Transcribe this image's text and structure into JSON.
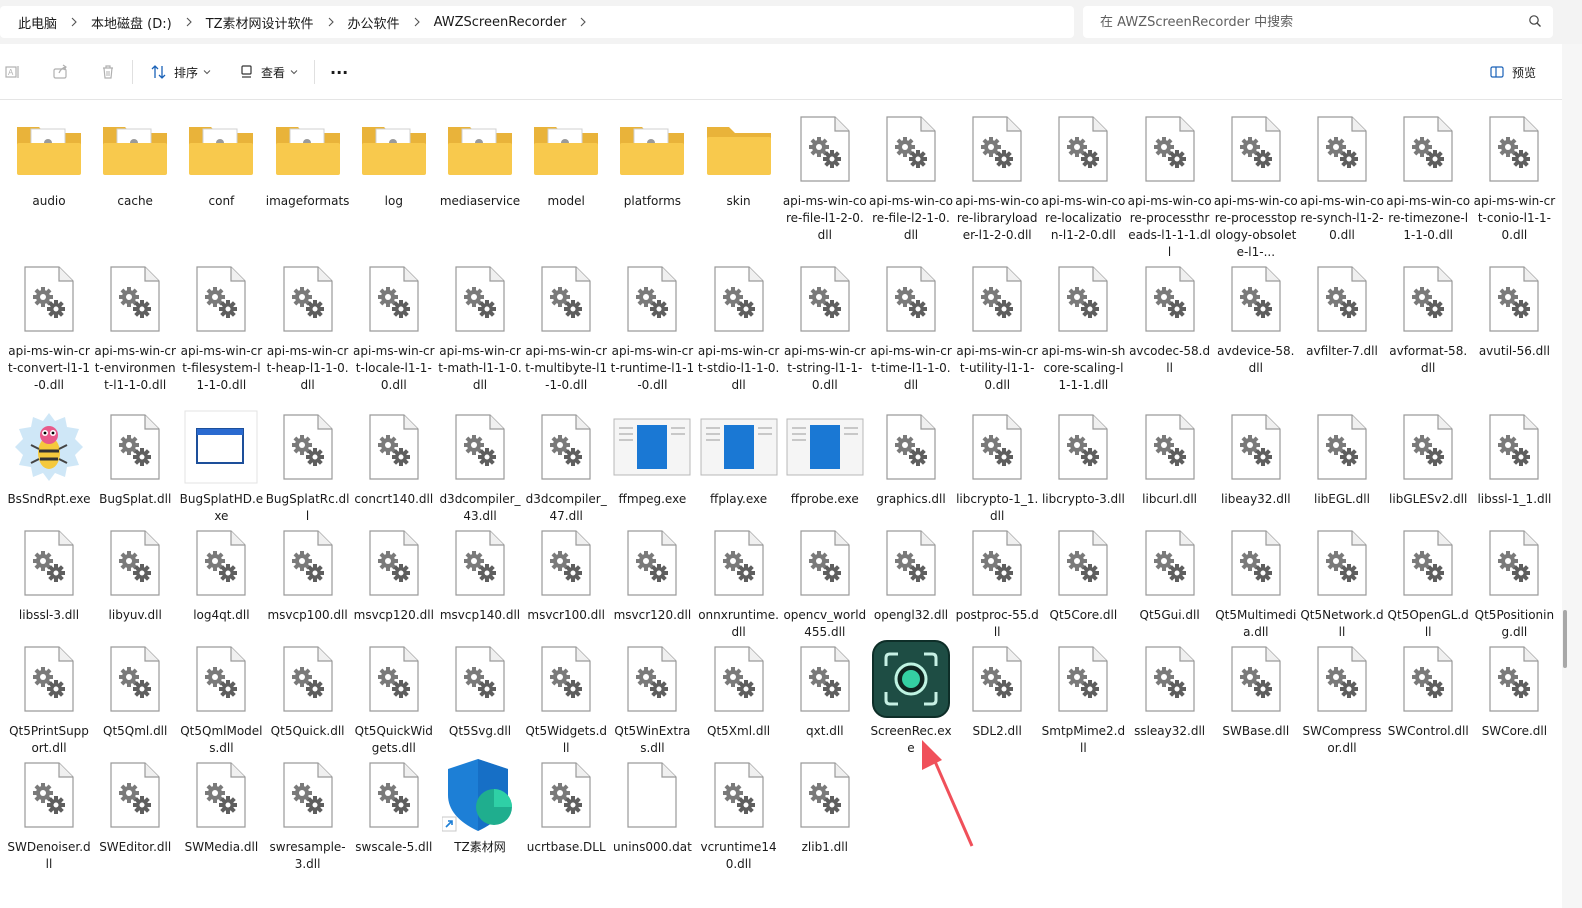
{
  "breadcrumb": [
    "此电脑",
    "本地磁盘 (D:)",
    "TZ素材网设计软件",
    "办公软件",
    "AWZScreenRecorder"
  ],
  "search": {
    "placeholder": "在 AWZScreenRecorder 中搜索"
  },
  "toolbar": {
    "sort_label": "排序",
    "view_label": "查看",
    "more_label": "···",
    "preview_label": "预览"
  },
  "colors": {
    "folder": "#f8c94d",
    "accent": "#0067c0",
    "arrow": "#f0505a",
    "app_icon_bg": "#1e4d44"
  },
  "files": [
    {
      "name": "audio",
      "icon": "folder-doc"
    },
    {
      "name": "cache",
      "icon": "folder-doc"
    },
    {
      "name": "conf",
      "icon": "folder-doc"
    },
    {
      "name": "imageformats",
      "icon": "folder-doc"
    },
    {
      "name": "log",
      "icon": "folder-doc"
    },
    {
      "name": "mediaservice",
      "icon": "folder-doc"
    },
    {
      "name": "model",
      "icon": "folder-doc"
    },
    {
      "name": "platforms",
      "icon": "folder-doc"
    },
    {
      "name": "skin",
      "icon": "folder"
    },
    {
      "name": "api-ms-win-core-file-l1-2-0.dll",
      "icon": "dll"
    },
    {
      "name": "api-ms-win-core-file-l2-1-0.dll",
      "icon": "dll"
    },
    {
      "name": "api-ms-win-core-libraryloader-l1-2-0.dll",
      "icon": "dll"
    },
    {
      "name": "api-ms-win-core-localization-l1-2-0.dll",
      "icon": "dll"
    },
    {
      "name": "api-ms-win-core-processthreads-l1-1-1.dll",
      "icon": "dll"
    },
    {
      "name": "api-ms-win-core-processtopology-obsolete-l1-...",
      "icon": "dll"
    },
    {
      "name": "api-ms-win-core-synch-l1-2-0.dll",
      "icon": "dll"
    },
    {
      "name": "api-ms-win-core-timezone-l1-1-0.dll",
      "icon": "dll"
    },
    {
      "name": "api-ms-win-crt-conio-l1-1-0.dll",
      "icon": "dll"
    },
    {
      "name": "api-ms-win-crt-convert-l1-1-0.dll",
      "icon": "dll"
    },
    {
      "name": "api-ms-win-crt-environment-l1-1-0.dll",
      "icon": "dll"
    },
    {
      "name": "api-ms-win-crt-filesystem-l1-1-0.dll",
      "icon": "dll"
    },
    {
      "name": "api-ms-win-crt-heap-l1-1-0.dll",
      "icon": "dll"
    },
    {
      "name": "api-ms-win-crt-locale-l1-1-0.dll",
      "icon": "dll"
    },
    {
      "name": "api-ms-win-crt-math-l1-1-0.dll",
      "icon": "dll"
    },
    {
      "name": "api-ms-win-crt-multibyte-l1-1-0.dll",
      "icon": "dll"
    },
    {
      "name": "api-ms-win-crt-runtime-l1-1-0.dll",
      "icon": "dll"
    },
    {
      "name": "api-ms-win-crt-stdio-l1-1-0.dll",
      "icon": "dll"
    },
    {
      "name": "api-ms-win-crt-string-l1-1-0.dll",
      "icon": "dll"
    },
    {
      "name": "api-ms-win-crt-time-l1-1-0.dll",
      "icon": "dll"
    },
    {
      "name": "api-ms-win-crt-utility-l1-1-0.dll",
      "icon": "dll"
    },
    {
      "name": "api-ms-win-shcore-scaling-l1-1-1.dll",
      "icon": "dll"
    },
    {
      "name": "avcodec-58.dll",
      "icon": "dll"
    },
    {
      "name": "avdevice-58.dll",
      "icon": "dll"
    },
    {
      "name": "avfilter-7.dll",
      "icon": "dll"
    },
    {
      "name": "avformat-58.dll",
      "icon": "dll"
    },
    {
      "name": "avutil-56.dll",
      "icon": "dll"
    },
    {
      "name": "BsSndRpt.exe",
      "icon": "bug-exe"
    },
    {
      "name": "BugSplat.dll",
      "icon": "dll"
    },
    {
      "name": "BugSplatHD.exe",
      "icon": "window-exe"
    },
    {
      "name": "BugSplatRc.dll",
      "icon": "dll"
    },
    {
      "name": "concrt140.dll",
      "icon": "dll"
    },
    {
      "name": "d3dcompiler_43.dll",
      "icon": "dll"
    },
    {
      "name": "d3dcompiler_47.dll",
      "icon": "dll"
    },
    {
      "name": "ffmpeg.exe",
      "icon": "blue-exe"
    },
    {
      "name": "ffplay.exe",
      "icon": "blue-exe"
    },
    {
      "name": "ffprobe.exe",
      "icon": "blue-exe"
    },
    {
      "name": "graphics.dll",
      "icon": "dll"
    },
    {
      "name": "libcrypto-1_1.dll",
      "icon": "dll"
    },
    {
      "name": "libcrypto-3.dll",
      "icon": "dll"
    },
    {
      "name": "libcurl.dll",
      "icon": "dll"
    },
    {
      "name": "libeay32.dll",
      "icon": "dll"
    },
    {
      "name": "libEGL.dll",
      "icon": "dll"
    },
    {
      "name": "libGLESv2.dll",
      "icon": "dll"
    },
    {
      "name": "libssl-1_1.dll",
      "icon": "dll"
    },
    {
      "name": "libssl-3.dll",
      "icon": "dll"
    },
    {
      "name": "libyuv.dll",
      "icon": "dll"
    },
    {
      "name": "log4qt.dll",
      "icon": "dll"
    },
    {
      "name": "msvcp100.dll",
      "icon": "dll"
    },
    {
      "name": "msvcp120.dll",
      "icon": "dll"
    },
    {
      "name": "msvcp140.dll",
      "icon": "dll"
    },
    {
      "name": "msvcr100.dll",
      "icon": "dll"
    },
    {
      "name": "msvcr120.dll",
      "icon": "dll"
    },
    {
      "name": "onnxruntime.dll",
      "icon": "dll"
    },
    {
      "name": "opencv_world455.dll",
      "icon": "dll"
    },
    {
      "name": "opengl32.dll",
      "icon": "dll"
    },
    {
      "name": "postproc-55.dll",
      "icon": "dll"
    },
    {
      "name": "Qt5Core.dll",
      "icon": "dll"
    },
    {
      "name": "Qt5Gui.dll",
      "icon": "dll"
    },
    {
      "name": "Qt5Multimedia.dll",
      "icon": "dll"
    },
    {
      "name": "Qt5Network.dll",
      "icon": "dll"
    },
    {
      "name": "Qt5OpenGL.dll",
      "icon": "dll"
    },
    {
      "name": "Qt5Positioning.dll",
      "icon": "dll"
    },
    {
      "name": "Qt5PrintSupport.dll",
      "icon": "dll"
    },
    {
      "name": "Qt5Qml.dll",
      "icon": "dll"
    },
    {
      "name": "Qt5QmlModels.dll",
      "icon": "dll"
    },
    {
      "name": "Qt5Quick.dll",
      "icon": "dll"
    },
    {
      "name": "Qt5QuickWidgets.dll",
      "icon": "dll"
    },
    {
      "name": "Qt5Svg.dll",
      "icon": "dll"
    },
    {
      "name": "Qt5Widgets.dll",
      "icon": "dll"
    },
    {
      "name": "Qt5WinExtras.dll",
      "icon": "dll"
    },
    {
      "name": "Qt5Xml.dll",
      "icon": "dll"
    },
    {
      "name": "qxt.dll",
      "icon": "dll"
    },
    {
      "name": "ScreenRec.exe",
      "icon": "app-exe"
    },
    {
      "name": "SDL2.dll",
      "icon": "dll"
    },
    {
      "name": "SmtpMime2.dll",
      "icon": "dll"
    },
    {
      "name": "ssleay32.dll",
      "icon": "dll"
    },
    {
      "name": "SWBase.dll",
      "icon": "dll"
    },
    {
      "name": "SWCompressor.dll",
      "icon": "dll"
    },
    {
      "name": "SWControl.dll",
      "icon": "dll"
    },
    {
      "name": "SWCore.dll",
      "icon": "dll"
    },
    {
      "name": "SWDenoiser.dll",
      "icon": "dll"
    },
    {
      "name": "SWEditor.dll",
      "icon": "dll"
    },
    {
      "name": "SWMedia.dll",
      "icon": "dll"
    },
    {
      "name": "swresample-3.dll",
      "icon": "dll"
    },
    {
      "name": "swscale-5.dll",
      "icon": "dll"
    },
    {
      "name": "TZ素材网",
      "icon": "shield-shortcut"
    },
    {
      "name": "ucrtbase.DLL",
      "icon": "dll"
    },
    {
      "name": "unins000.dat",
      "icon": "blank"
    },
    {
      "name": "vcruntime140.dll",
      "icon": "dll"
    },
    {
      "name": "zlib1.dll",
      "icon": "dll"
    }
  ]
}
